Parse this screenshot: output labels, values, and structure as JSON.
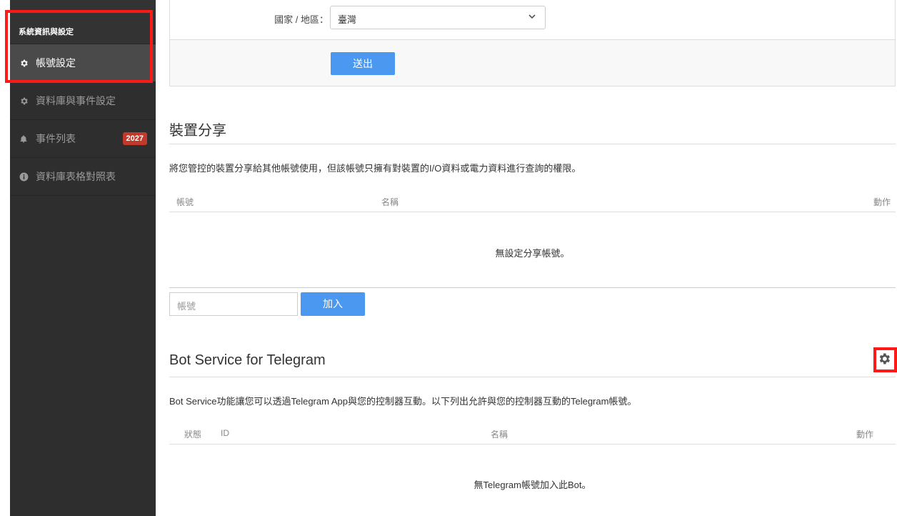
{
  "sidebar": {
    "header": "系統資訊與設定",
    "items": [
      {
        "label": "帳號設定",
        "icon": "gear-icon",
        "active": true
      },
      {
        "label": "資料庫與事件設定",
        "icon": "gear-icon"
      },
      {
        "label": "事件列表",
        "icon": "bell-icon",
        "badge": "2027"
      },
      {
        "label": "資料庫表格對照表",
        "icon": "info-icon"
      }
    ]
  },
  "form": {
    "country_label": "國家 / 地區：",
    "country_value": "臺灣",
    "submit_label": "送出"
  },
  "device_share": {
    "title": "裝置分享",
    "description": "將您管控的裝置分享給其他帳號使用，但該帳號只擁有對裝置的I/O資料或電力資料進行查詢的權限。",
    "columns": [
      "帳號",
      "名稱",
      "動作"
    ],
    "empty_message": "無設定分享帳號。",
    "account_placeholder": "帳號",
    "add_label": "加入"
  },
  "telegram": {
    "title": "Bot Service for Telegram",
    "description": "Bot Service功能讓您可以透過Telegram App與您的控制器互動。以下列出允許與您的控制器互動的Telegram帳號。",
    "columns": [
      "狀態",
      "ID",
      "名稱",
      "動作"
    ],
    "empty_message": "無Telegram帳號加入此Bot。"
  },
  "colors": {
    "accent": "#4a98f0",
    "badge": "#c0392b",
    "highlight": "#ff1a1a",
    "sidebar": "#2e2e2e"
  }
}
